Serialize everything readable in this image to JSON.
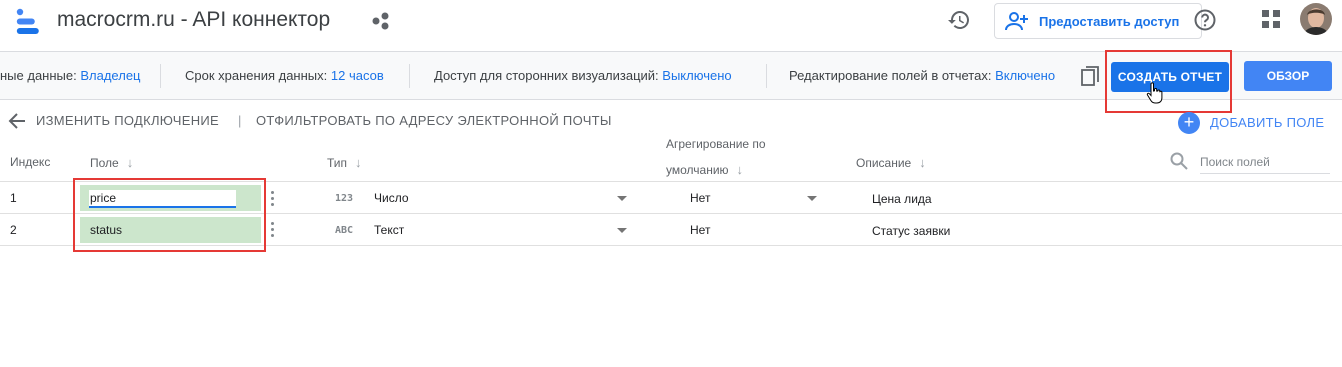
{
  "header": {
    "app_title": "macrocrm.ru - API коннектор",
    "share_button_label": "Предоставить доступ"
  },
  "infobar": {
    "credentials_label": "ные данные:",
    "credentials_value": "Владелец",
    "freshness_label": "Срок хранения данных:",
    "freshness_value": "12 часов",
    "community_label": "Доступ для сторонних визуализаций:",
    "community_value": "Выключено",
    "field_editing_label": "Редактирование полей в отчетах:",
    "field_editing_value": "Включено",
    "create_report_label": "СОЗДАТЬ ОТЧЕТ",
    "explore_label": "ОБЗОР"
  },
  "actions": {
    "edit_connection": "ИЗМЕНИТЬ ПОДКЛЮЧЕНИЕ",
    "separator": "|",
    "filter_by_email": "ОТФИЛЬТРОВАТЬ ПО АДРЕСУ ЭЛЕКТРОННОЙ ПОЧТЫ",
    "add_field": "ДОБАВИТЬ ПОЛЕ"
  },
  "table": {
    "columns": {
      "index": "Индекс",
      "field": "Поле",
      "type": "Тип",
      "aggregation_line1": "Агрегирование по",
      "aggregation_line2": "умолчанию",
      "description": "Описание"
    },
    "search_placeholder": "Поиск полей",
    "rows": [
      {
        "index": "1",
        "field": "price",
        "type_icon": "123",
        "type": "Число",
        "aggregation": "Нет",
        "description": "Цена лида"
      },
      {
        "index": "2",
        "field": "status",
        "type_icon": "ABC",
        "type": "Текст",
        "aggregation": "Нет",
        "description": "Статус заявки"
      }
    ]
  },
  "colors": {
    "accent": "#1a73e8",
    "highlight_field": "#cce6cc",
    "annotation_box": "#e53935"
  }
}
